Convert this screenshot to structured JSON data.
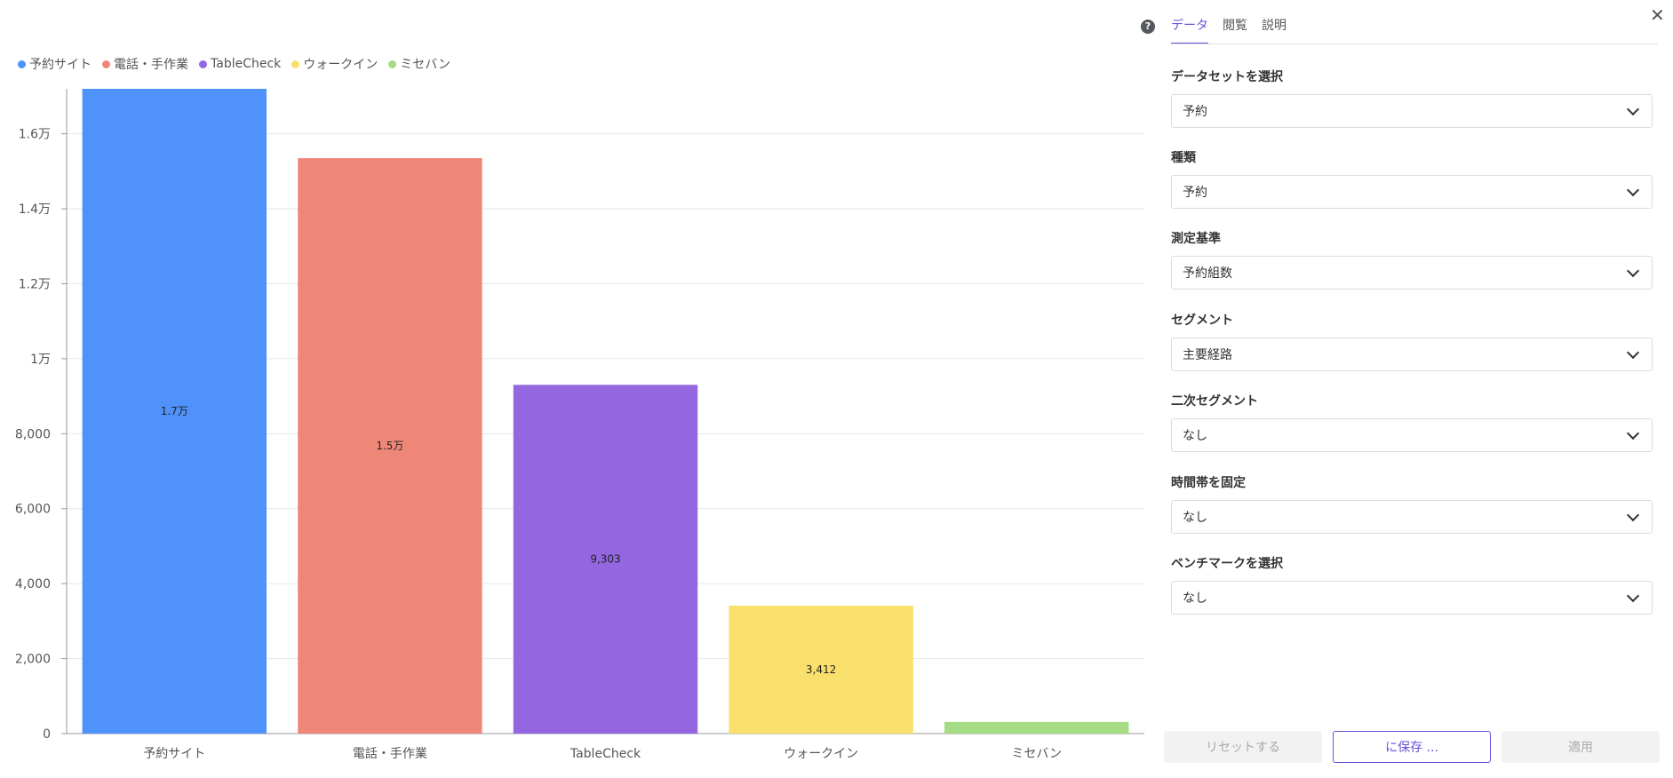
{
  "chart_data": {
    "type": "bar",
    "categories": [
      "予約サイト",
      "電話・手作業",
      "TableCheck",
      "ウォークイン",
      "ミセバン"
    ],
    "values": [
      17200,
      15350,
      9303,
      3412,
      310
    ],
    "value_labels": [
      "1.7万",
      "1.5万",
      "9,303",
      "3,412",
      ""
    ],
    "colors": [
      "#4f92fb",
      "#ef8779",
      "#9467e1",
      "#f9df6c",
      "#a5dc83"
    ],
    "ylim": [
      0,
      17200
    ],
    "ticks": [
      0,
      2000,
      4000,
      6000,
      8000,
      10000,
      12000,
      14000,
      16000
    ],
    "tick_labels": [
      "0",
      "2,000",
      "4,000",
      "6,000",
      "8,000",
      "1万",
      "1.2万",
      "1.4万",
      "1.6万"
    ],
    "legend": [
      {
        "name": "予約サイト",
        "color": "#4f92fb"
      },
      {
        "name": "電話・手作業",
        "color": "#ef8779"
      },
      {
        "name": "TableCheck",
        "color": "#9467e1"
      },
      {
        "name": "ウォークイン",
        "color": "#f9df6c"
      },
      {
        "name": "ミセバン",
        "color": "#a5dc83"
      }
    ],
    "legend_position": "top-left",
    "grid": true
  },
  "panel": {
    "help_icon": "question-circle-icon",
    "help_glyph": "?",
    "close_glyph": "✕",
    "tabs": [
      {
        "label": "データ",
        "active": true
      },
      {
        "label": "閲覧",
        "active": false
      },
      {
        "label": "説明",
        "active": false
      }
    ],
    "fields": [
      {
        "label": "データセットを選択",
        "value": "予約"
      },
      {
        "label": "種類",
        "value": "予約"
      },
      {
        "label": "測定基準",
        "value": "予約組数"
      },
      {
        "label": "セグメント",
        "value": "主要経路"
      },
      {
        "label": "二次セグメント",
        "value": "なし"
      },
      {
        "label": "時間帯を固定",
        "value": "なし"
      },
      {
        "label": "ベンチマークを選択",
        "value": "なし"
      }
    ],
    "buttons": {
      "reset": "リセットする",
      "save": "に保存 ...",
      "apply": "適用"
    },
    "accent_color": "#6b4fd8"
  }
}
